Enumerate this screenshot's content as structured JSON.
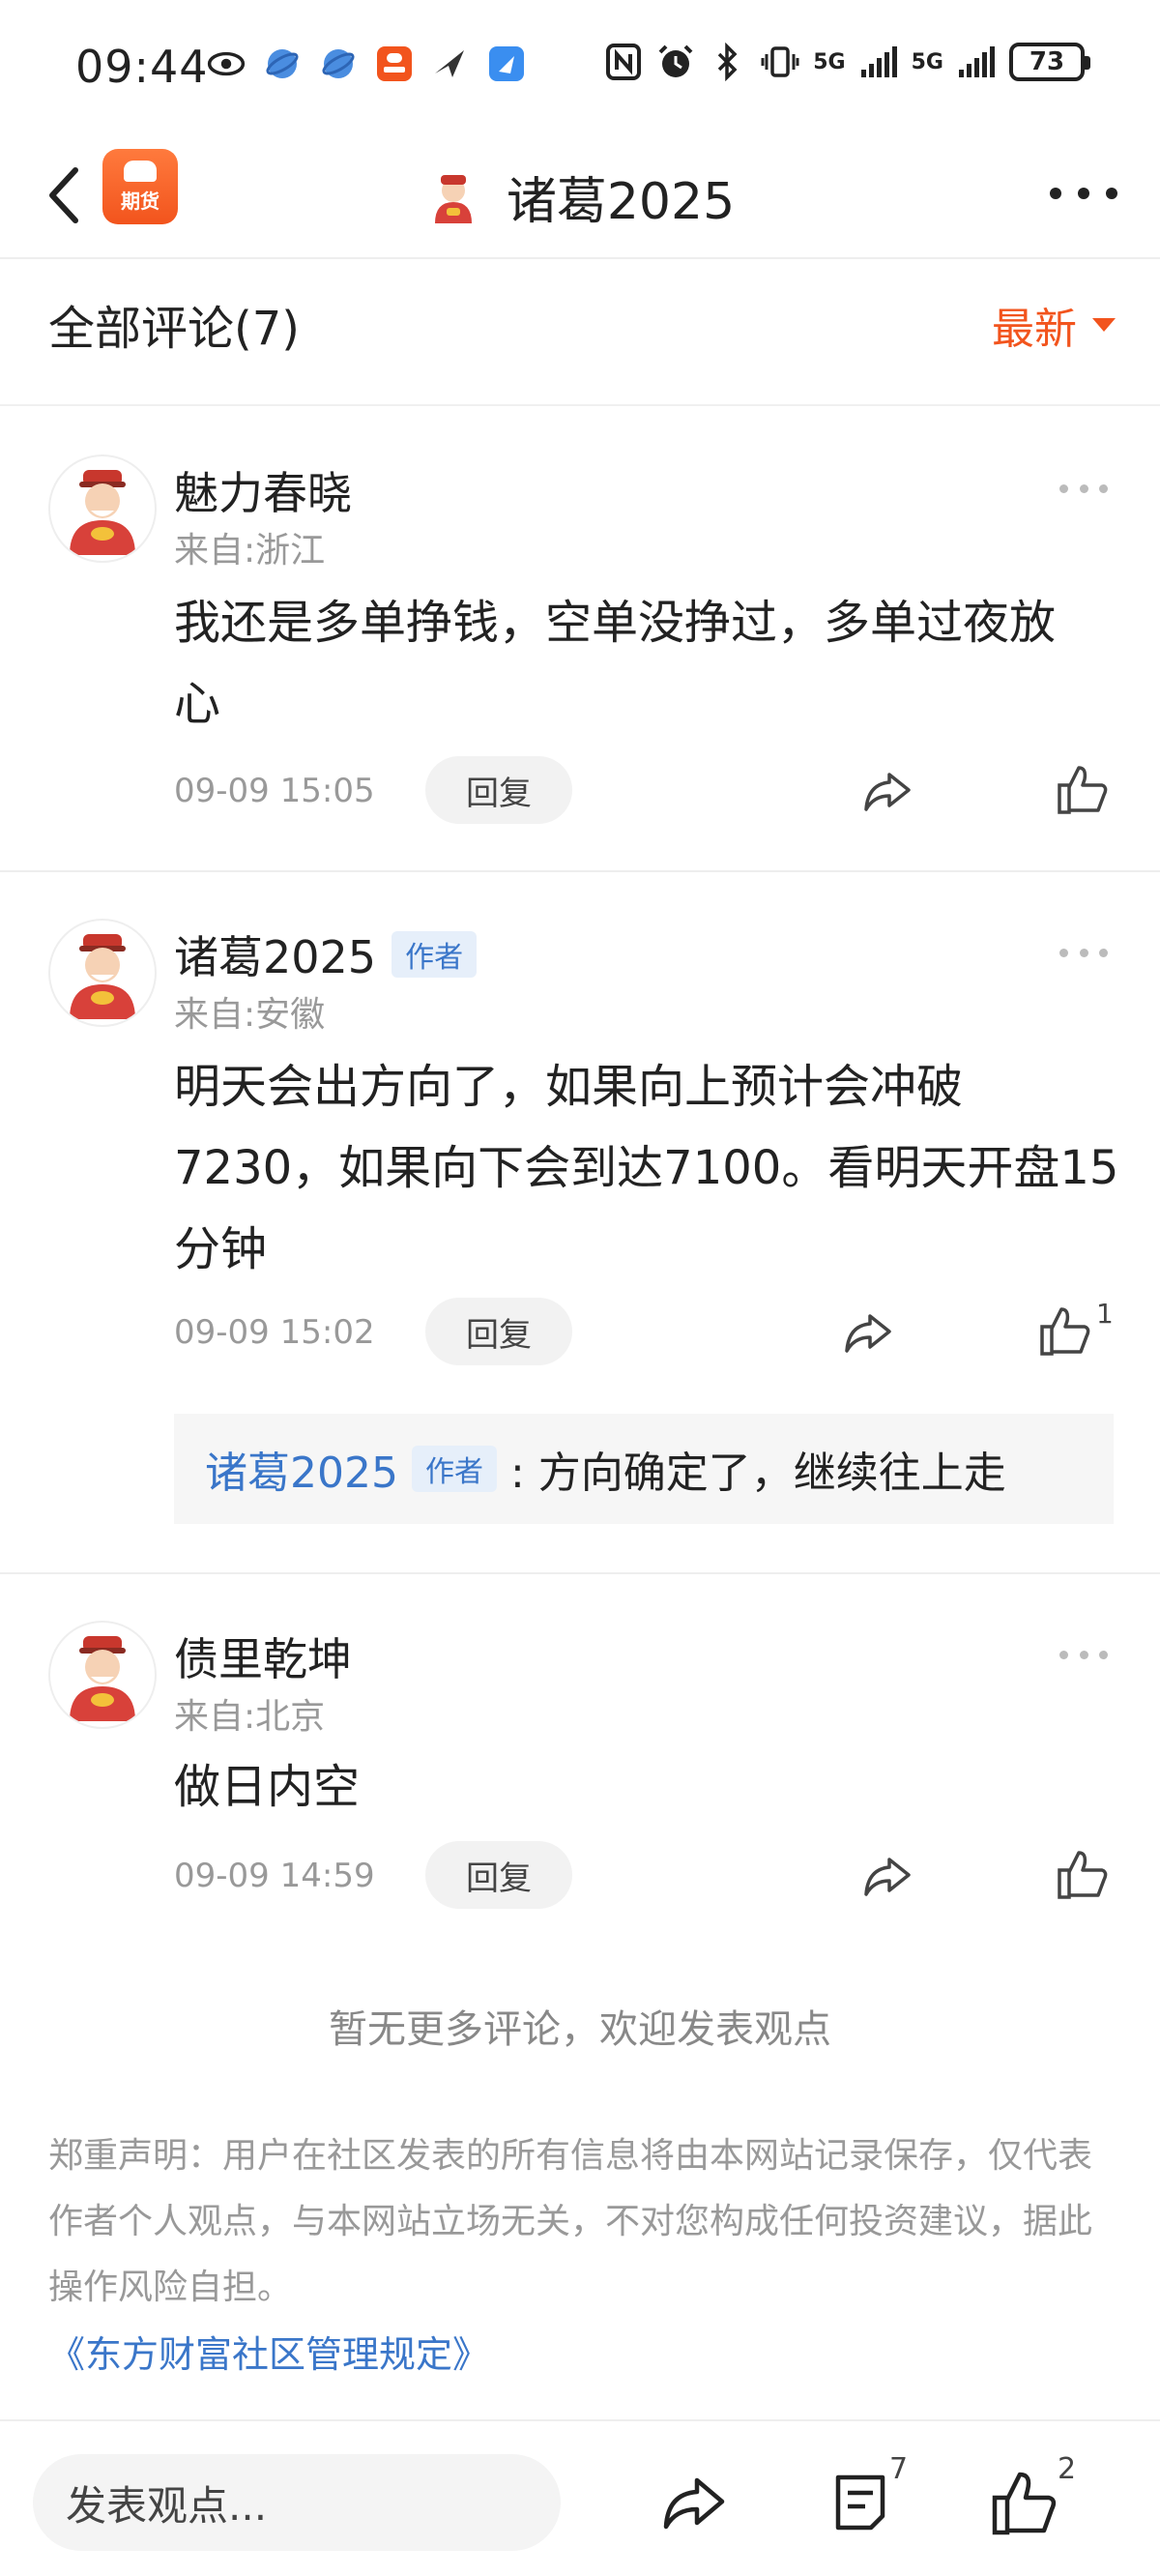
{
  "status_bar": {
    "time": "09:44",
    "battery": "73",
    "net1": "5G",
    "net2": "5G"
  },
  "header": {
    "app_badge": "期货",
    "title": "诸葛2025"
  },
  "comments_header": {
    "title": "全部评论(7)",
    "sort": "最新"
  },
  "comments": [
    {
      "name": "魅力春晓",
      "location": "来自:浙江",
      "text": "我还是多单挣钱，空单没挣过，多单过夜放心",
      "time": "09-09 15:05",
      "reply_label": "回复",
      "likes": ""
    },
    {
      "name": "诸葛2025",
      "author_tag": "作者",
      "location": "来自:安徽",
      "text": "明天会出方向了，如果向上预计会冲破7230，如果向下会到达7100。看明天开盘15分钟",
      "time": "09-09 15:02",
      "reply_label": "回复",
      "likes": "1",
      "sub_reply": {
        "name": "诸葛2025",
        "author_tag": "作者",
        "text": ": 方向确定了，继续往上走"
      }
    },
    {
      "name": "债里乾坤",
      "location": "来自:北京",
      "text": "做日内空",
      "time": "09-09 14:59",
      "reply_label": "回复",
      "likes": ""
    }
  ],
  "footer": {
    "no_more": "暂无更多评论，欢迎发表观点",
    "disclaimer": "郑重声明：用户在社区发表的所有信息将由本网站记录保存，仅代表作者个人观点，与本网站立场无关，不对您构成任何投资建议，据此操作风险自担。",
    "rules_link": "《东方财富社区管理规定》"
  },
  "bottom_bar": {
    "input_placeholder": "发表观点...",
    "comment_count": "7",
    "like_count": "2"
  },
  "colors": {
    "accent": "#f2541d",
    "link": "#3a76c9"
  }
}
